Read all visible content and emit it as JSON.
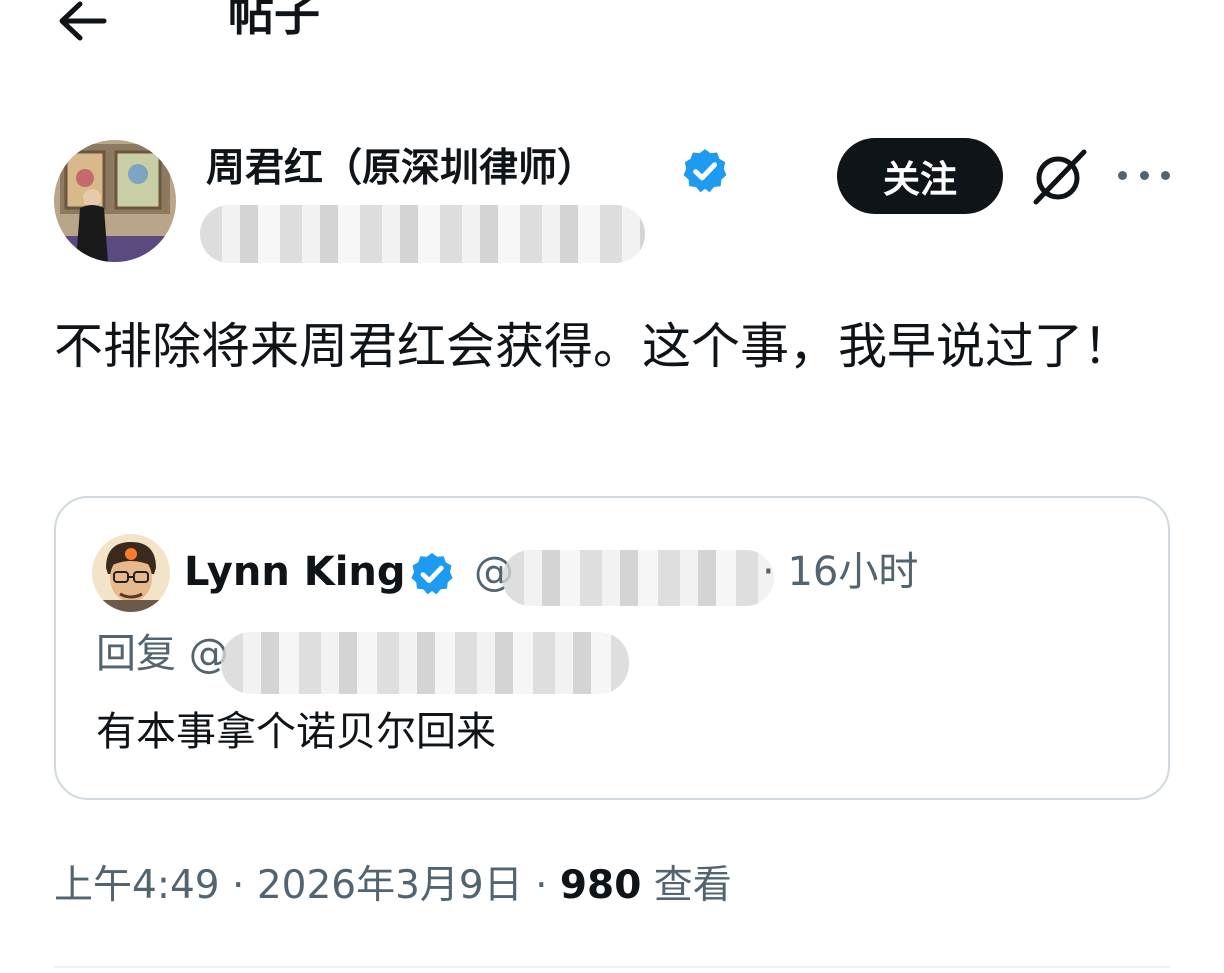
{
  "header": {
    "back_icon": "arrow-left-icon",
    "title": "帖子"
  },
  "post": {
    "author_name": "周君红（原深圳律师）",
    "verified_icon": "verified-badge-icon",
    "verified_color": "#1d9bf0",
    "follow_label": "关注",
    "grok_icon": "grok-icon",
    "more_icon": "more-dots-icon",
    "text": "不排除将来周君红会获得。这个事，我早说过了！"
  },
  "quote": {
    "author_name": "Lynn King",
    "at_prefix": "@",
    "time_separator": "·",
    "time": "16小时",
    "reply_label": "回复 @",
    "text": "有本事拿个诺贝尔回来"
  },
  "meta": {
    "time": "上午4:49",
    "date": "2026年3月9日",
    "separator": "·",
    "views_count": "980",
    "views_label": "查看"
  },
  "colors": {
    "text_primary": "#0f1419",
    "text_secondary": "#536471",
    "follow_bg": "#0f1419",
    "border": "#cfd9de"
  }
}
